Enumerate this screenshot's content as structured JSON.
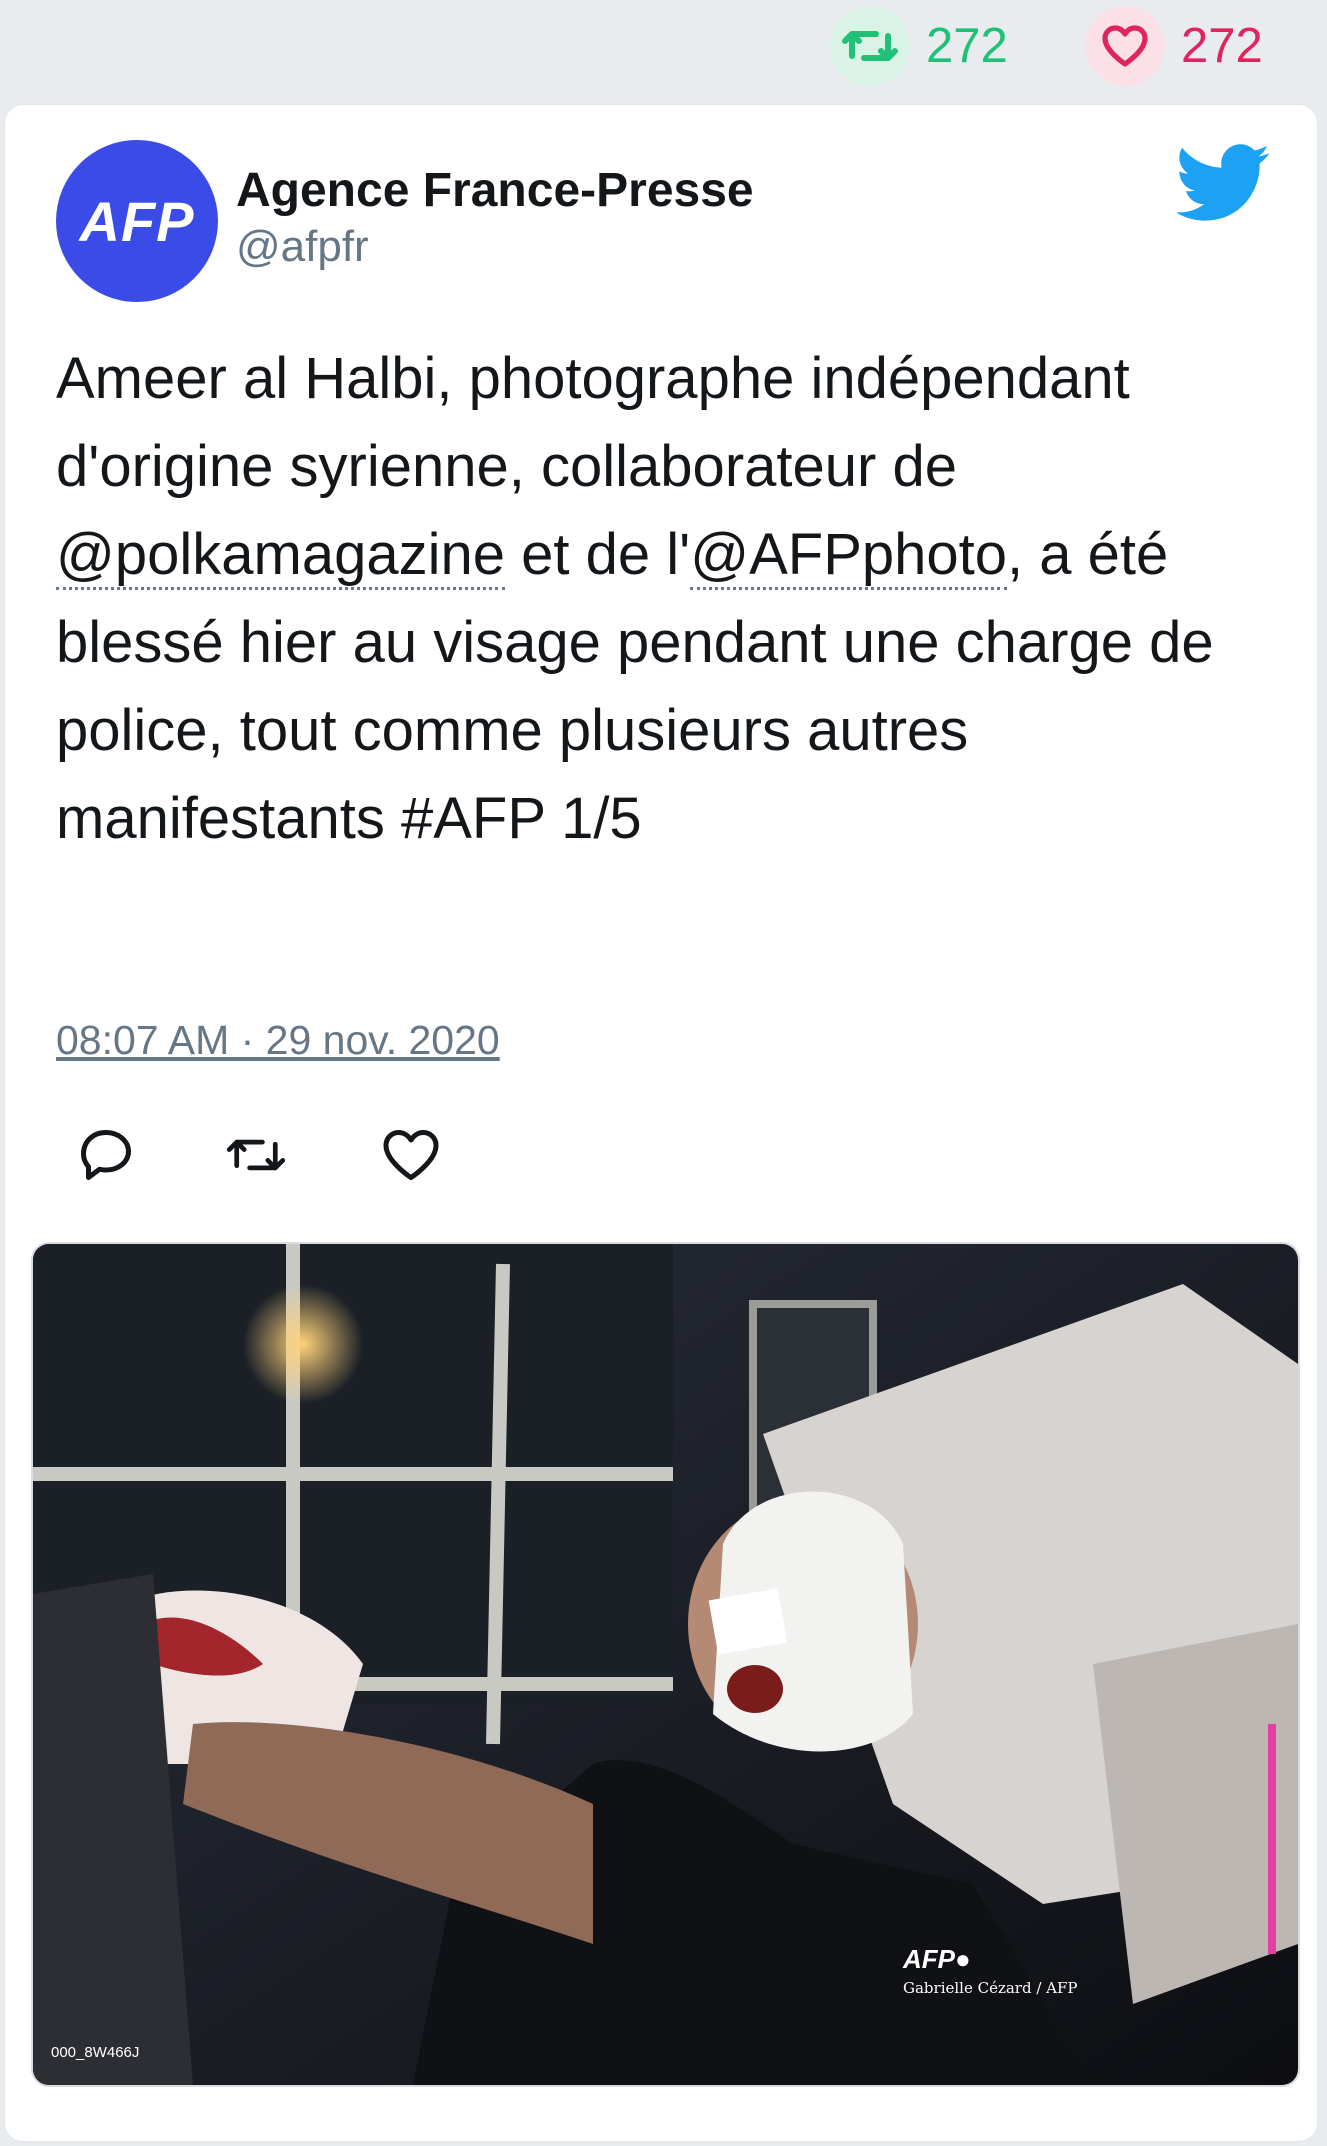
{
  "stats": {
    "retweets": "272",
    "likes": "272",
    "retweet_color": "#20c177",
    "like_color": "#e0245e"
  },
  "tweet": {
    "author_name": "Agence France-Presse",
    "author_handle": "@afpfr",
    "avatar_text": "AFP",
    "avatar_color": "#3a4be8",
    "platform_icon": "twitter-bird-icon",
    "text_part1": "Ameer al Halbi, photographe indépendant d'origine syrienne, collaborateur de ",
    "mention1": "@polkamagazine",
    "text_part2": " et de l'",
    "mention2": "@AFPphoto",
    "text_part3": ", a été blessé hier au visage pendant une charge de police, tout comme plusieurs autres manifestants #AFP 1/5",
    "timestamp": "08:07 AM · 29 nov. 2020",
    "actions": [
      "reply-icon",
      "retweet-icon",
      "like-icon"
    ]
  },
  "media": {
    "credit_logo": "AFP●",
    "credit_name": "Gabrielle Cézard / AFP",
    "photo_id": "000_8W466J"
  }
}
